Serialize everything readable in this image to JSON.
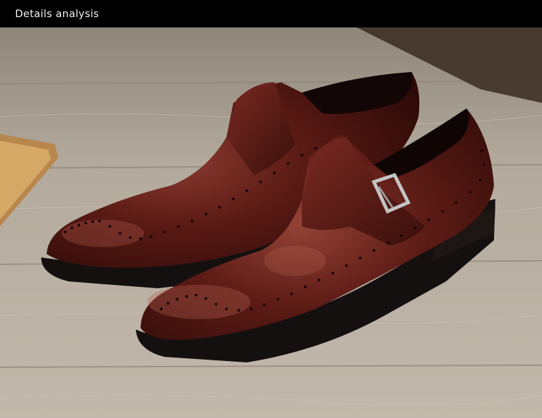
{
  "header": {
    "title": "Details analysis"
  },
  "photo": {
    "subject": "pair-of-burgundy-brogue-monk-strap-shoes",
    "colors": {
      "leather": "#4a1410",
      "leather_highlight": "#8a3a2e",
      "sole": "#151010",
      "wood": "#b7ada0",
      "buckle": "#b9b9b9"
    }
  }
}
